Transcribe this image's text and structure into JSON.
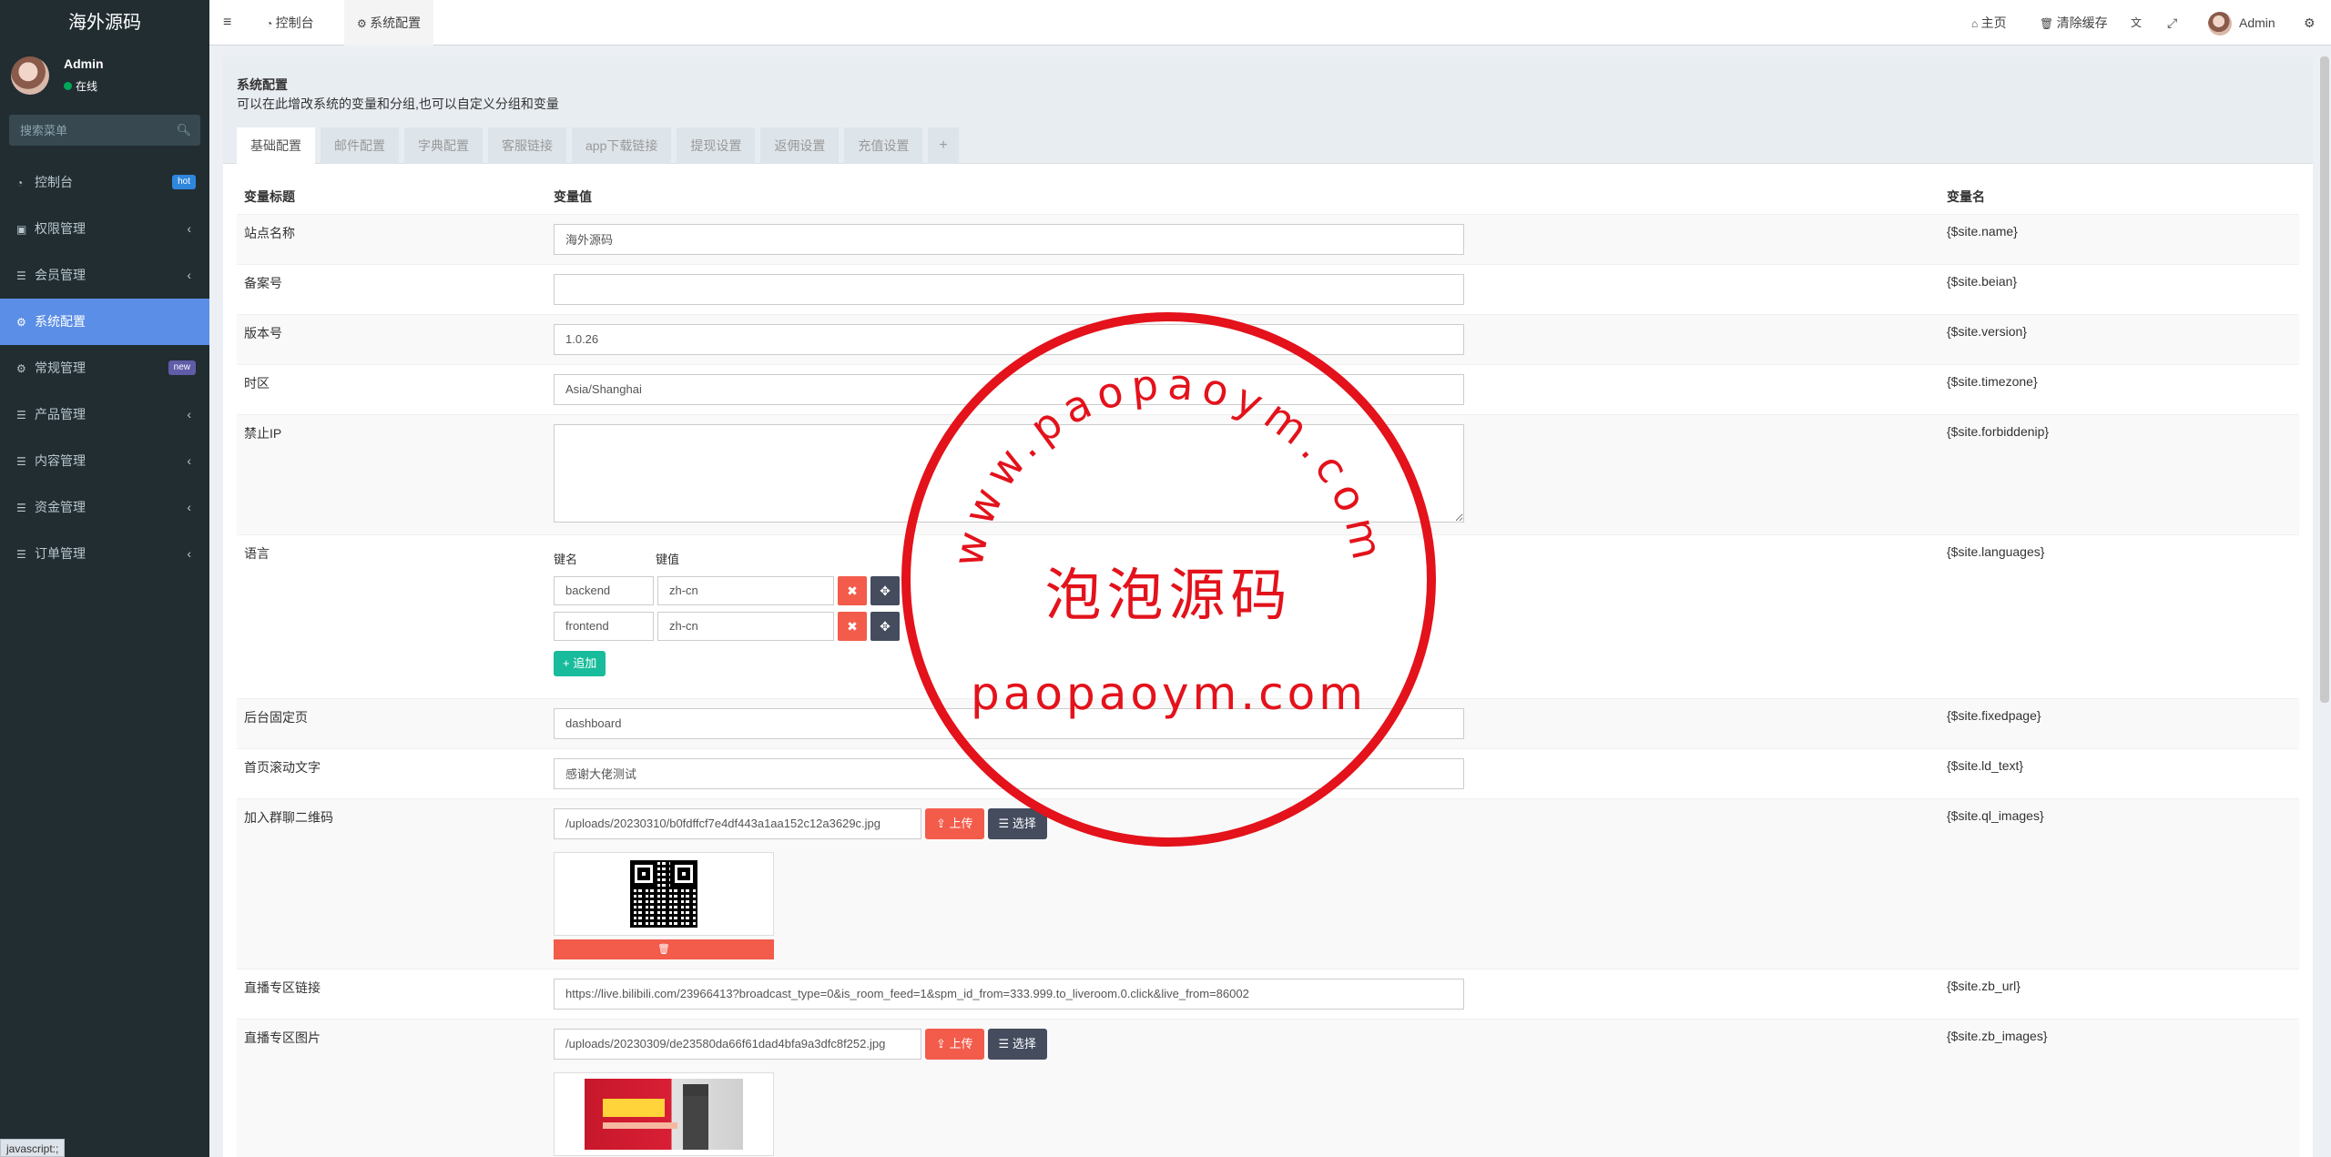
{
  "app": {
    "logo": "海外源码"
  },
  "user": {
    "name": "Admin",
    "status": "在线"
  },
  "search": {
    "placeholder": "搜索菜单"
  },
  "menu": [
    {
      "label": "控制台",
      "icon": "dashboard-icon",
      "badge": "hot"
    },
    {
      "label": "权限管理",
      "icon": "group-icon"
    },
    {
      "label": "会员管理",
      "icon": "list-icon"
    },
    {
      "label": "系统配置",
      "icon": "gear-icon"
    },
    {
      "label": "常规管理",
      "icon": "cogs-icon",
      "badge": "new"
    },
    {
      "label": "产品管理",
      "icon": "list-icon"
    },
    {
      "label": "内容管理",
      "icon": "list-icon"
    },
    {
      "label": "资金管理",
      "icon": "list-icon"
    },
    {
      "label": "订单管理",
      "icon": "list-icon"
    }
  ],
  "header": {
    "tabs": [
      {
        "label": "控制台"
      },
      {
        "label": "系统配置"
      }
    ],
    "home": "主页",
    "clear_cache": "清除缓存",
    "user": "Admin"
  },
  "panel": {
    "title": "系统配置",
    "desc": "可以在此增改系统的变量和分组,也可以自定义分组和变量"
  },
  "config_tabs": [
    "基础配置",
    "邮件配置",
    "字典配置",
    "客服链接",
    "app下载链接",
    "提现设置",
    "返佣设置",
    "充值设置",
    "+"
  ],
  "table": {
    "headers": [
      "变量标题",
      "变量值",
      "变量名"
    ],
    "rows": [
      {
        "title": "站点名称",
        "value": "海外源码",
        "name": "{$site.name}"
      },
      {
        "title": "备案号",
        "value": "",
        "name": "{$site.beian}"
      },
      {
        "title": "版本号",
        "value": "1.0.26",
        "name": "{$site.version}"
      },
      {
        "title": "时区",
        "value": "Asia/Shanghai",
        "name": "{$site.timezone}"
      },
      {
        "title": "禁止IP",
        "value": "",
        "name": "{$site.forbiddenip}"
      },
      {
        "title": "语言",
        "name": "{$site.languages}",
        "key_label": "键名",
        "val_label": "键值",
        "pairs": [
          {
            "k": "backend",
            "v": "zh-cn"
          },
          {
            "k": "frontend",
            "v": "zh-cn"
          }
        ],
        "add_label": "追加"
      },
      {
        "title": "后台固定页",
        "value": "dashboard",
        "name": "{$site.fixedpage}"
      },
      {
        "title": "首页滚动文字",
        "value": "感谢大佬测试",
        "name": "{$site.ld_text}"
      },
      {
        "title": "加入群聊二维码",
        "value": "/uploads/20230310/b0fdffcf7e4df443a1aa152c12a3629c.jpg",
        "name": "{$site.ql_images}"
      },
      {
        "title": "直播专区链接",
        "value": "https://live.bilibili.com/23966413?broadcast_type=0&is_room_feed=1&spm_id_from=333.999.to_liveroom.0.click&live_from=86002",
        "name": "{$site.zb_url}"
      },
      {
        "title": "直播专区图片",
        "value": "/uploads/20230309/de23580da66f61dad4bfa9a3dfc8f252.jpg",
        "name": "{$site.zb_images}"
      }
    ],
    "upload_label": "上传",
    "select_label": "选择"
  },
  "stamp": {
    "arc_text": "www.paopaoym.com",
    "center_text": "泡泡源码",
    "domain": "paopaoym.com",
    "color": "#e3121b"
  },
  "statusbar": {
    "text": "javascript:;"
  },
  "colors": {
    "sidebar": "#222d32",
    "active": "#5b8ee6",
    "danger": "#f35b4b",
    "success": "#18bc9c",
    "dark_btn": "#444c5e"
  }
}
